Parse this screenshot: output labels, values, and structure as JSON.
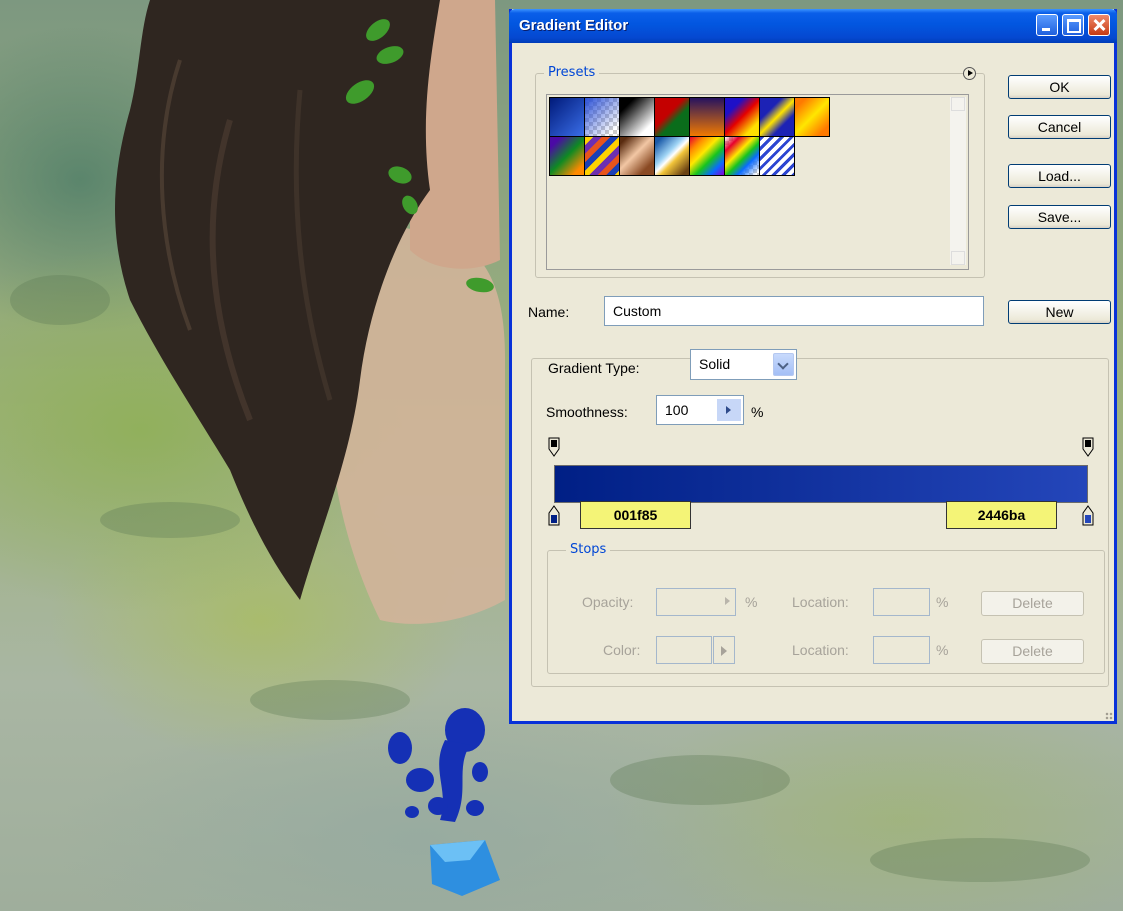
{
  "window": {
    "title": "Gradient Editor",
    "controls": {
      "minimize_icon": "minimize-icon",
      "maximize_icon": "maximize-icon",
      "close_icon": "close-icon"
    }
  },
  "presets": {
    "legend": "Presets",
    "menu_icon": "circle-arrow-menu-icon",
    "swatches": [
      "blue-gradient",
      "blue-transparent-checker",
      "black-white",
      "red-green",
      "violet-orange",
      "blue-red-yellow",
      "blue-yellow-blue",
      "orange-yellow-orange",
      "violet-green-orange",
      "yellow-violet-orange-blue",
      "copper",
      "chrome",
      "spectrum",
      "transparent-rainbow",
      "transparent-stripes"
    ]
  },
  "buttons": {
    "ok": "OK",
    "cancel": "Cancel",
    "load": "Load...",
    "save": "Save...",
    "new": "New"
  },
  "name": {
    "label": "Name:",
    "value": "Custom"
  },
  "gradient": {
    "type_label": "Gradient Type:",
    "type_value": "Solid",
    "smoothness_label": "Smoothness:",
    "smoothness_value": "100",
    "smoothness_unit": "%",
    "color_start": "#001f85",
    "color_end": "#2446ba",
    "stop_label_left": "001f85",
    "stop_label_right": "2446ba"
  },
  "stops": {
    "legend": "Stops",
    "opacity_label": "Opacity:",
    "opacity_unit": "%",
    "location_label_1": "Location:",
    "location_unit_1": "%",
    "delete_1": "Delete",
    "color_label": "Color:",
    "location_label_2": "Location:",
    "location_unit_2": "%",
    "delete_2": "Delete"
  }
}
